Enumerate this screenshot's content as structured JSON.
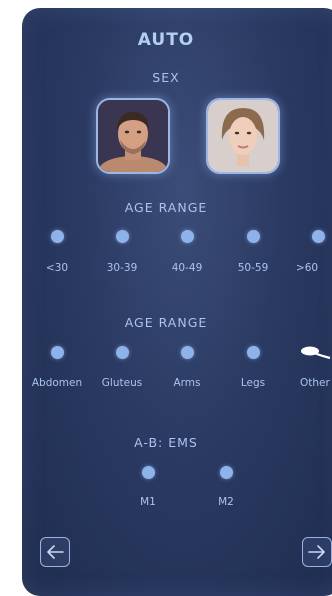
{
  "title": "AUTO",
  "sex_label": "SEX",
  "sex_options": [
    {
      "name": "male-avatar"
    },
    {
      "name": "female-avatar"
    }
  ],
  "age_section_label": "AGE RANGE",
  "age_options": [
    "<30",
    "30-39",
    "40-49",
    "50-59",
    ">60"
  ],
  "area_section_label": "AGE RANGE",
  "area_options": [
    "Abdomen",
    "Gluteus",
    "Arms",
    "Legs",
    "Other"
  ],
  "ems_section_label": "A-B: EMS",
  "ems_options": [
    "M1",
    "M2"
  ],
  "nav": {
    "back_icon": "arrow-left-icon",
    "next_icon": "arrow-right-icon"
  },
  "colors": {
    "panel": "#2a3a62",
    "accent": "#8eb3ea",
    "text": "#aac4ec"
  }
}
